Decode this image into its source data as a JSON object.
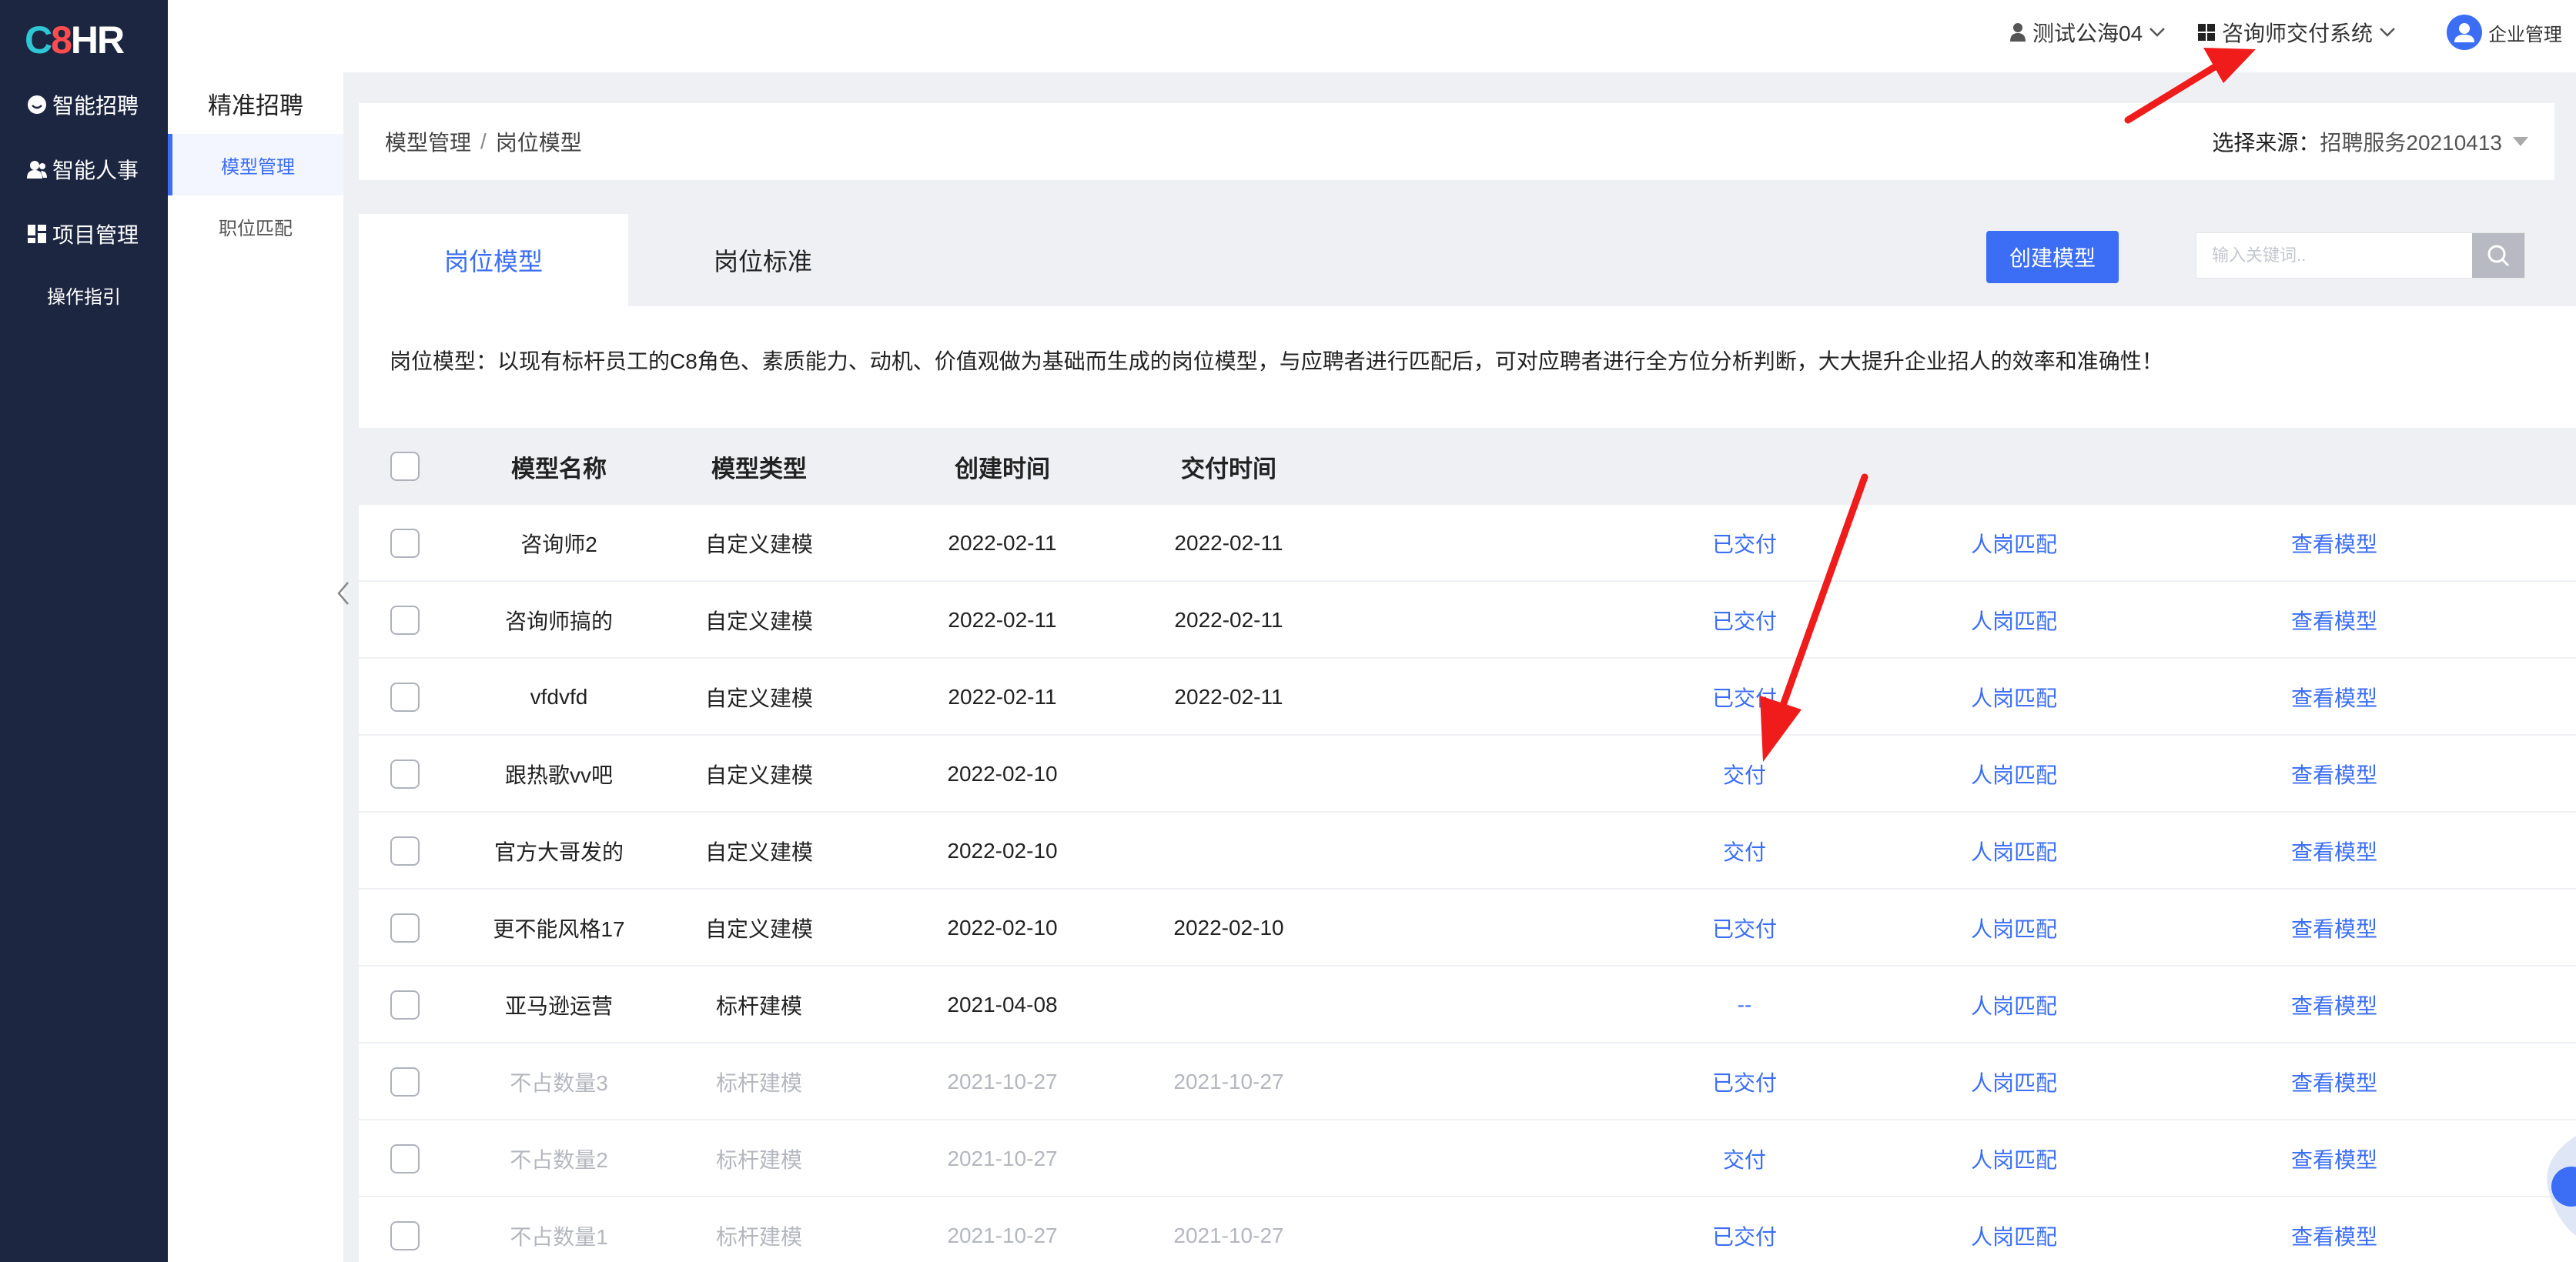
{
  "sidebar": {
    "logo_c": "C",
    "logo_8": "8",
    "logo_hr": "HR",
    "nav": [
      {
        "label": "智能招聘",
        "icon": "smile-icon"
      },
      {
        "label": "智能人事",
        "icon": "users-icon"
      },
      {
        "label": "项目管理",
        "icon": "grid-icon"
      }
    ],
    "guide_label": "操作指引"
  },
  "subside": {
    "title": "精准招聘",
    "items": [
      {
        "label": "模型管理",
        "active": true
      },
      {
        "label": "职位匹配",
        "active": false
      }
    ]
  },
  "topbar": {
    "user": "测试公海04",
    "system": "咨询师交付系统",
    "enterprise": "企业管理"
  },
  "breadcrumb": {
    "parent": "模型管理",
    "sep": "/",
    "current": "岗位模型"
  },
  "source": {
    "label": "选择来源：",
    "value": "招聘服务20210413"
  },
  "tabs": [
    {
      "label": "岗位模型",
      "active": true
    },
    {
      "label": "岗位标准",
      "active": false
    }
  ],
  "create_button": "创建模型",
  "search": {
    "placeholder": "输入关键词..",
    "value": ""
  },
  "description": "岗位模型：以现有标杆员工的C8角色、素质能力、动机、价值观做为基础而生成的岗位模型，与应聘者进行匹配后，可对应聘者进行全方位分析判断，大大提升企业招人的效率和准确性！",
  "table": {
    "headers": [
      "模型名称",
      "模型类型",
      "创建时间",
      "交付时间"
    ],
    "rows": [
      {
        "name": "咨询师2",
        "type": "自定义建模",
        "created": "2022-02-11",
        "delivered": "2022-02-11",
        "status": "已交付",
        "match": "人岗匹配",
        "view": "查看模型",
        "dim": false
      },
      {
        "name": "咨询师搞的",
        "type": "自定义建模",
        "created": "2022-02-11",
        "delivered": "2022-02-11",
        "status": "已交付",
        "match": "人岗匹配",
        "view": "查看模型",
        "dim": false
      },
      {
        "name": "vfdvfd",
        "type": "自定义建模",
        "created": "2022-02-11",
        "delivered": "2022-02-11",
        "status": "已交付",
        "match": "人岗匹配",
        "view": "查看模型",
        "dim": false
      },
      {
        "name": "跟热歌vv吧",
        "type": "自定义建模",
        "created": "2022-02-10",
        "delivered": "",
        "status": "交付",
        "match": "人岗匹配",
        "view": "查看模型",
        "dim": false
      },
      {
        "name": "官方大哥发的",
        "type": "自定义建模",
        "created": "2022-02-10",
        "delivered": "",
        "status": "交付",
        "match": "人岗匹配",
        "view": "查看模型",
        "dim": false
      },
      {
        "name": "更不能风格17",
        "type": "自定义建模",
        "created": "2022-02-10",
        "delivered": "2022-02-10",
        "status": "已交付",
        "match": "人岗匹配",
        "view": "查看模型",
        "dim": false
      },
      {
        "name": "亚马逊运营",
        "type": "标杆建模",
        "created": "2021-04-08",
        "delivered": "",
        "status": "--",
        "match": "人岗匹配",
        "view": "查看模型",
        "dim": false
      },
      {
        "name": "不占数量3",
        "type": "标杆建模",
        "created": "2021-10-27",
        "delivered": "2021-10-27",
        "status": "已交付",
        "match": "人岗匹配",
        "view": "查看模型",
        "dim": true
      },
      {
        "name": "不占数量2",
        "type": "标杆建模",
        "created": "2021-10-27",
        "delivered": "",
        "status": "交付",
        "match": "人岗匹配",
        "view": "查看模型",
        "dim": true
      },
      {
        "name": "不占数量1",
        "type": "标杆建模",
        "created": "2021-10-27",
        "delivered": "2021-10-27",
        "status": "已交付",
        "match": "人岗匹配",
        "view": "查看模型",
        "dim": true
      }
    ]
  },
  "colors": {
    "sidebar_bg": "#1c2640",
    "accent": "#3b6ef5",
    "annotation_arrow": "#f01b1b",
    "dim_text": "#b4b7be"
  }
}
